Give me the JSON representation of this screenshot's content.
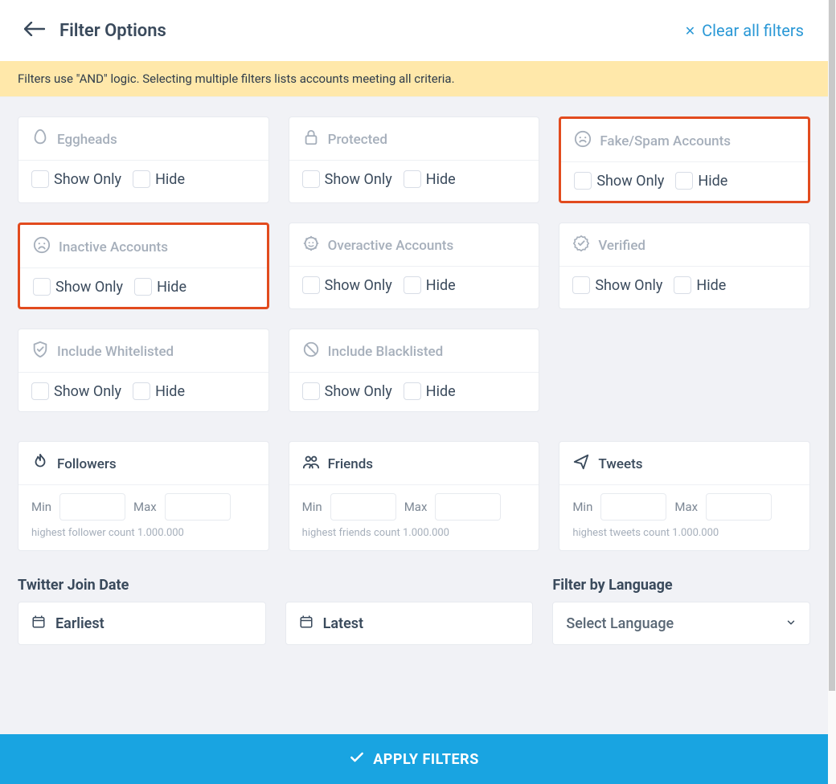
{
  "header": {
    "title": "Filter Options",
    "clear_label": "Clear all filters"
  },
  "banner": "Filters use \"AND\" logic. Selecting multiple filters lists accounts meeting all criteria.",
  "labels": {
    "show_only": "Show Only",
    "hide": "Hide",
    "min": "Min",
    "max": "Max"
  },
  "cards": {
    "eggheads": "Eggheads",
    "protected": "Protected",
    "fakespam": "Fake/Spam Accounts",
    "inactive": "Inactive Accounts",
    "overactive": "Overactive Accounts",
    "verified": "Verified",
    "whitelisted": "Include Whitelisted",
    "blacklisted": "Include Blacklisted"
  },
  "ranges": {
    "followers": {
      "title": "Followers",
      "helper": "highest follower count 1.000.000"
    },
    "friends": {
      "title": "Friends",
      "helper": "highest friends count 1.000.000"
    },
    "tweets": {
      "title": "Tweets",
      "helper": "highest tweets count 1.000.000"
    }
  },
  "join_date": {
    "heading": "Twitter Join Date",
    "earliest": "Earliest",
    "latest": "Latest"
  },
  "language": {
    "heading": "Filter by Language",
    "placeholder": "Select Language"
  },
  "apply": "APPLY FILTERS"
}
